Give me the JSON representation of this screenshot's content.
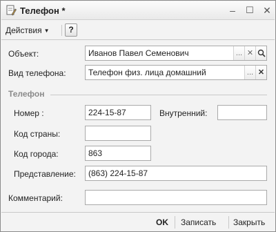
{
  "window": {
    "title": "Телефон *",
    "minimize_glyph": "–",
    "maximize_glyph": "☐",
    "close_glyph": "✕"
  },
  "toolbar": {
    "actions_label": "Действия",
    "actions_arrow": "▼",
    "help_label": "?"
  },
  "form": {
    "object_label": "Объект:",
    "object_value": "Иванов Павел Семенович",
    "phone_type_label": "Вид телефона:",
    "phone_type_value": "Телефон физ. лица домашний",
    "section_title": "Телефон",
    "number_label": "Номер :",
    "number_value": "224-15-87",
    "internal_label": "Внутренний:",
    "internal_value": "",
    "country_code_label": "Код страны:",
    "country_code_value": "",
    "city_code_label": "Код города:",
    "city_code_value": "863",
    "representation_label": "Представление:",
    "representation_value": "(863) 224-15-87",
    "comment_label": "Комментарий:",
    "comment_value": "",
    "select_glyph": "...",
    "clear_glyph": "✕",
    "search_glyph": "🔍"
  },
  "footer": {
    "ok_label": "OK",
    "save_label": "Записать",
    "close_label": "Закрыть"
  }
}
